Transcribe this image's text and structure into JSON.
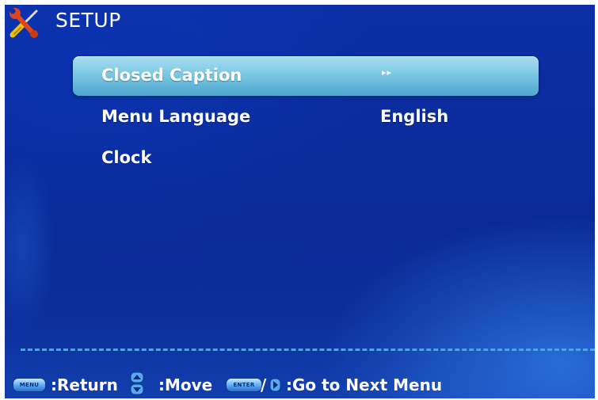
{
  "header": {
    "title": "SETUP",
    "icon": "tools-icon"
  },
  "menu": {
    "items": [
      {
        "label": "Closed Caption",
        "value": "",
        "arrow": "▸▸",
        "selected": true
      },
      {
        "label": "Menu Language",
        "value": "English",
        "selected": false
      },
      {
        "label": "Clock",
        "value": "",
        "selected": false
      }
    ]
  },
  "footer": {
    "menu_key": "MENU",
    "return_text": ":Return",
    "move_text": ":Move",
    "enter_key": "ENTER",
    "slash": "/",
    "next_text": ":Go to Next Menu"
  },
  "colors": {
    "background": "#0c2fa6",
    "highlight": "#7cc8e4",
    "divider": "#4fa3e6",
    "text": "#ffffff"
  }
}
